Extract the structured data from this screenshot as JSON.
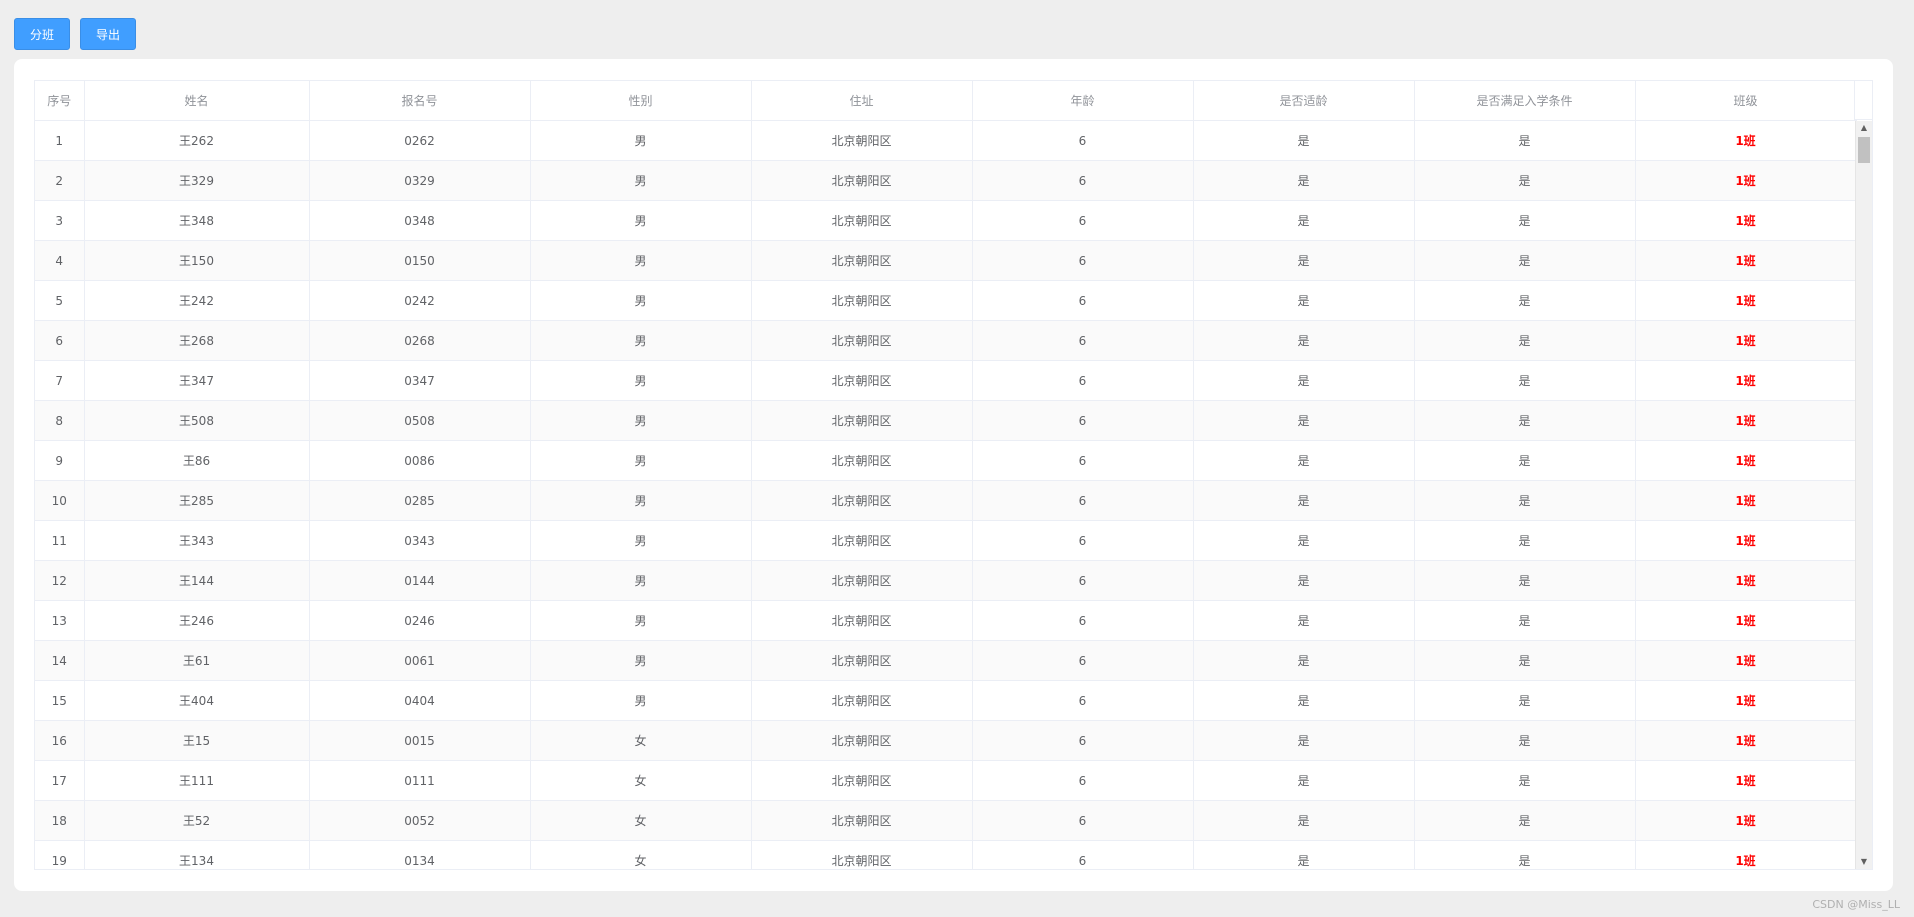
{
  "toolbar": {
    "split_label": "分班",
    "export_label": "导出"
  },
  "table": {
    "headers": [
      "序号",
      "姓名",
      "报名号",
      "性别",
      "住址",
      "年龄",
      "是否适龄",
      "是否满足入学条件",
      "班级"
    ],
    "rows": [
      [
        "1",
        "王262",
        "0262",
        "男",
        "北京朝阳区",
        "6",
        "是",
        "是",
        "1班"
      ],
      [
        "2",
        "王329",
        "0329",
        "男",
        "北京朝阳区",
        "6",
        "是",
        "是",
        "1班"
      ],
      [
        "3",
        "王348",
        "0348",
        "男",
        "北京朝阳区",
        "6",
        "是",
        "是",
        "1班"
      ],
      [
        "4",
        "王150",
        "0150",
        "男",
        "北京朝阳区",
        "6",
        "是",
        "是",
        "1班"
      ],
      [
        "5",
        "王242",
        "0242",
        "男",
        "北京朝阳区",
        "6",
        "是",
        "是",
        "1班"
      ],
      [
        "6",
        "王268",
        "0268",
        "男",
        "北京朝阳区",
        "6",
        "是",
        "是",
        "1班"
      ],
      [
        "7",
        "王347",
        "0347",
        "男",
        "北京朝阳区",
        "6",
        "是",
        "是",
        "1班"
      ],
      [
        "8",
        "王508",
        "0508",
        "男",
        "北京朝阳区",
        "6",
        "是",
        "是",
        "1班"
      ],
      [
        "9",
        "王86",
        "0086",
        "男",
        "北京朝阳区",
        "6",
        "是",
        "是",
        "1班"
      ],
      [
        "10",
        "王285",
        "0285",
        "男",
        "北京朝阳区",
        "6",
        "是",
        "是",
        "1班"
      ],
      [
        "11",
        "王343",
        "0343",
        "男",
        "北京朝阳区",
        "6",
        "是",
        "是",
        "1班"
      ],
      [
        "12",
        "王144",
        "0144",
        "男",
        "北京朝阳区",
        "6",
        "是",
        "是",
        "1班"
      ],
      [
        "13",
        "王246",
        "0246",
        "男",
        "北京朝阳区",
        "6",
        "是",
        "是",
        "1班"
      ],
      [
        "14",
        "王61",
        "0061",
        "男",
        "北京朝阳区",
        "6",
        "是",
        "是",
        "1班"
      ],
      [
        "15",
        "王404",
        "0404",
        "男",
        "北京朝阳区",
        "6",
        "是",
        "是",
        "1班"
      ],
      [
        "16",
        "王15",
        "0015",
        "女",
        "北京朝阳区",
        "6",
        "是",
        "是",
        "1班"
      ],
      [
        "17",
        "王111",
        "0111",
        "女",
        "北京朝阳区",
        "6",
        "是",
        "是",
        "1班"
      ],
      [
        "18",
        "王52",
        "0052",
        "女",
        "北京朝阳区",
        "6",
        "是",
        "是",
        "1班"
      ],
      [
        "19",
        "王134",
        "0134",
        "女",
        "北京朝阳区",
        "6",
        "是",
        "是",
        "1班"
      ]
    ]
  },
  "colors": {
    "primary": "#409eff",
    "class_text": "#ff0000"
  },
  "icons": {
    "scroll_up": "▲",
    "scroll_down": "▼"
  },
  "watermark": "CSDN @Miss_LL"
}
